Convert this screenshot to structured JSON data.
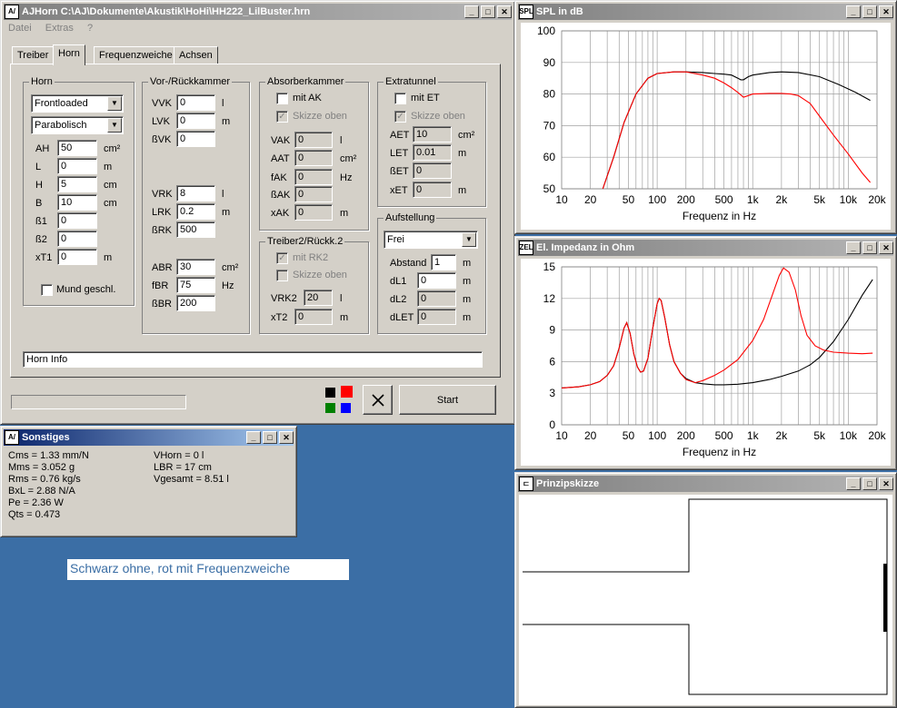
{
  "main_window": {
    "title": "AJHorn  C:\\AJ\\Dokumente\\Akustik\\HoHi\\HH222_LilBuster.hrn",
    "menu": [
      "Datei",
      "Extras",
      "?"
    ],
    "tabs": [
      "Treiber",
      "Horn",
      "Frequenzweiche",
      "Achsen"
    ],
    "horn": {
      "legend": "Horn",
      "type_select": "Frontloaded",
      "profile_select": "Parabolisch",
      "fields": [
        {
          "label": "AH",
          "value": "50",
          "unit": "cm²"
        },
        {
          "label": "L",
          "value": "0",
          "unit": "m"
        },
        {
          "label": "H",
          "value": "5",
          "unit": "cm"
        },
        {
          "label": "B",
          "value": "10",
          "unit": "cm"
        },
        {
          "label": "ß1",
          "value": "0",
          "unit": ""
        },
        {
          "label": "ß2",
          "value": "0",
          "unit": ""
        },
        {
          "label": "xT1",
          "value": "0",
          "unit": "m"
        }
      ],
      "mund_label": "Mund geschl."
    },
    "vor": {
      "legend": "Vor-/Rückkammer",
      "vvk": {
        "label": "VVK",
        "value": "0",
        "unit": "l"
      },
      "lvk": {
        "label": "LVK",
        "value": "0",
        "unit": "m"
      },
      "bvk": {
        "label": "ßVK",
        "value": "0"
      },
      "vrk": {
        "label": "VRK",
        "value": "8",
        "unit": "l"
      },
      "lrk": {
        "label": "LRK",
        "value": "0.2",
        "unit": "m"
      },
      "brk": {
        "label": "ßRK",
        "value": "500"
      },
      "abr": {
        "label": "ABR",
        "value": "30",
        "unit": "cm²"
      },
      "fbr": {
        "label": "fBR",
        "value": "75",
        "unit": "Hz"
      },
      "bbr": {
        "label": "ßBR",
        "value": "200"
      }
    },
    "absorber": {
      "legend": "Absorberkammer",
      "mit_ak": "mit AK",
      "skizze": "Skizze oben",
      "vak": {
        "label": "VAK",
        "value": "0",
        "unit": "l"
      },
      "aat": {
        "label": "AAT",
        "value": "0",
        "unit": "cm²"
      },
      "fak": {
        "label": "fAK",
        "value": "0",
        "unit": "Hz"
      },
      "bak": {
        "label": "ßAK",
        "value": "0"
      },
      "xak": {
        "label": "xAK",
        "value": "0",
        "unit": "m"
      }
    },
    "treiber2": {
      "legend": "Treiber2/Rückk.2",
      "mit_rk2": "mit RK2",
      "skizze": "Skizze oben",
      "vrk2": {
        "label": "VRK2",
        "value": "20",
        "unit": "l"
      },
      "xt2": {
        "label": "xT2",
        "value": "0",
        "unit": "m"
      }
    },
    "extratunnel": {
      "legend": "Extratunnel",
      "mit_et": "mit ET",
      "skizze": "Skizze oben",
      "aet": {
        "label": "AET",
        "value": "10",
        "unit": "cm²"
      },
      "let": {
        "label": "LET",
        "value": "0.01",
        "unit": "m"
      },
      "bet": {
        "label": "ßET",
        "value": "0"
      },
      "xet": {
        "label": "xET",
        "value": "0",
        "unit": "m"
      }
    },
    "aufstellung": {
      "legend": "Aufstellung",
      "select": "Frei",
      "abstand": {
        "label": "Abstand",
        "value": "1",
        "unit": "m"
      },
      "dl1": {
        "label": "dL1",
        "value": "0",
        "unit": "m"
      },
      "dl2": {
        "label": "dL2",
        "value": "0",
        "unit": "m"
      },
      "dlet": {
        "label": "dLET",
        "value": "0",
        "unit": "m"
      }
    },
    "horn_info": "Horn Info",
    "start_label": "Start",
    "colors": [
      "#000000",
      "#ff0000",
      "#008000",
      "#0000ff"
    ]
  },
  "sonstiges": {
    "title": "Sonstiges",
    "left": [
      "Cms = 1.33 mm/N",
      "Mms = 3.052 g",
      "Rms = 0.76 kg/s",
      "BxL = 2.88 N/A",
      "Pe = 2.36 W",
      "Qts = 0.473"
    ],
    "right": [
      "VHorn = 0 l",
      "LBR = 17 cm",
      "Vgesamt = 8.51 l"
    ]
  },
  "caption": "Schwarz ohne, rot mit Frequenzweiche",
  "spl_window": {
    "title": "SPL in dB",
    "icon": "SPL"
  },
  "impedance_window": {
    "title": "El. Impedanz in Ohm",
    "icon": "ZEL"
  },
  "sketch_window": {
    "title": "Prinzipskizze"
  },
  "chart_data": [
    {
      "type": "line",
      "title": "SPL in dB",
      "xlabel": "Frequenz in Hz",
      "ylabel": "",
      "xscale": "log",
      "xlim": [
        10,
        20000
      ],
      "ylim": [
        50,
        100
      ],
      "x_ticks": [
        10,
        20,
        50,
        100,
        200,
        500,
        1000,
        2000,
        5000,
        10000,
        20000
      ],
      "x_tick_labels": [
        "10",
        "20",
        "50",
        "100",
        "200",
        "500",
        "1k",
        "2k",
        "5k",
        "10k",
        "20k"
      ],
      "y_ticks": [
        50,
        60,
        70,
        80,
        90,
        100
      ],
      "grid": true,
      "series": [
        {
          "color": "#000000",
          "x": [
            27,
            35,
            45,
            60,
            80,
            100,
            150,
            200,
            300,
            400,
            500,
            600,
            700,
            750,
            800,
            900,
            1000,
            1500,
            2000,
            3000,
            5000,
            8000,
            12000,
            17000
          ],
          "y": [
            50,
            60,
            71,
            80,
            85,
            86.5,
            87,
            87,
            86.8,
            86.5,
            86.3,
            86,
            85,
            84.5,
            84.5,
            85.5,
            86,
            86.8,
            87,
            86.8,
            85.5,
            83,
            80.5,
            78
          ]
        },
        {
          "color": "#ff0000",
          "x": [
            27,
            35,
            45,
            60,
            80,
            100,
            150,
            200,
            300,
            400,
            500,
            600,
            700,
            800,
            900,
            1000,
            1500,
            2000,
            2500,
            3000,
            4000,
            5000,
            7000,
            10000,
            14000,
            17000
          ],
          "y": [
            50,
            60,
            71,
            80,
            85,
            86.5,
            87,
            87,
            86,
            85,
            83.5,
            82,
            80.5,
            79,
            79.5,
            80,
            80.2,
            80.2,
            80,
            79.5,
            77,
            73,
            67,
            61,
            55,
            52
          ]
        }
      ]
    },
    {
      "type": "line",
      "title": "El. Impedanz in Ohm",
      "xlabel": "Frequenz in Hz",
      "ylabel": "",
      "xscale": "log",
      "xlim": [
        10,
        20000
      ],
      "ylim": [
        0,
        15
      ],
      "x_ticks": [
        10,
        20,
        50,
        100,
        200,
        500,
        1000,
        2000,
        5000,
        10000,
        20000
      ],
      "x_tick_labels": [
        "10",
        "20",
        "50",
        "100",
        "200",
        "500",
        "1k",
        "2k",
        "5k",
        "10k",
        "20k"
      ],
      "y_ticks": [
        0,
        3,
        6,
        9,
        12,
        15
      ],
      "grid": true,
      "series": [
        {
          "color": "#000000",
          "x": [
            10,
            15,
            20,
            25,
            30,
            35,
            40,
            45,
            48,
            52,
            57,
            62,
            67,
            72,
            80,
            90,
            100,
            105,
            110,
            120,
            135,
            150,
            175,
            200,
            250,
            300,
            400,
            500,
            700,
            1000,
            1500,
            2000,
            3000,
            4000,
            5000,
            7000,
            10000,
            14000,
            18000
          ],
          "y": [
            3.5,
            3.6,
            3.8,
            4.1,
            4.7,
            5.6,
            7.3,
            9.2,
            9.7,
            8.7,
            6.7,
            5.5,
            5.0,
            5.1,
            6.3,
            9.2,
            11.5,
            12.0,
            11.8,
            10.2,
            7.6,
            6.0,
            4.9,
            4.4,
            4.0,
            3.9,
            3.8,
            3.8,
            3.85,
            4.0,
            4.3,
            4.6,
            5.1,
            5.7,
            6.4,
            7.9,
            10.0,
            12.3,
            13.8
          ]
        },
        {
          "color": "#ff0000",
          "x": [
            10,
            15,
            20,
            25,
            30,
            35,
            40,
            45,
            48,
            52,
            57,
            62,
            67,
            72,
            80,
            90,
            100,
            105,
            110,
            120,
            135,
            150,
            175,
            200,
            250,
            300,
            400,
            500,
            700,
            1000,
            1300,
            1600,
            1900,
            2100,
            2400,
            2800,
            3200,
            3700,
            4500,
            5500,
            7000,
            10000,
            14000,
            18000
          ],
          "y": [
            3.5,
            3.6,
            3.8,
            4.1,
            4.7,
            5.6,
            7.3,
            9.2,
            9.7,
            8.7,
            6.7,
            5.5,
            5.0,
            5.1,
            6.3,
            9.2,
            11.5,
            12.0,
            11.8,
            10.2,
            7.6,
            6.0,
            4.9,
            4.3,
            4.0,
            4.2,
            4.7,
            5.2,
            6.2,
            8.0,
            10.0,
            12.3,
            14.2,
            14.9,
            14.5,
            12.8,
            10.4,
            8.5,
            7.5,
            7.1,
            6.9,
            6.8,
            6.75,
            6.8
          ]
        }
      ]
    }
  ]
}
